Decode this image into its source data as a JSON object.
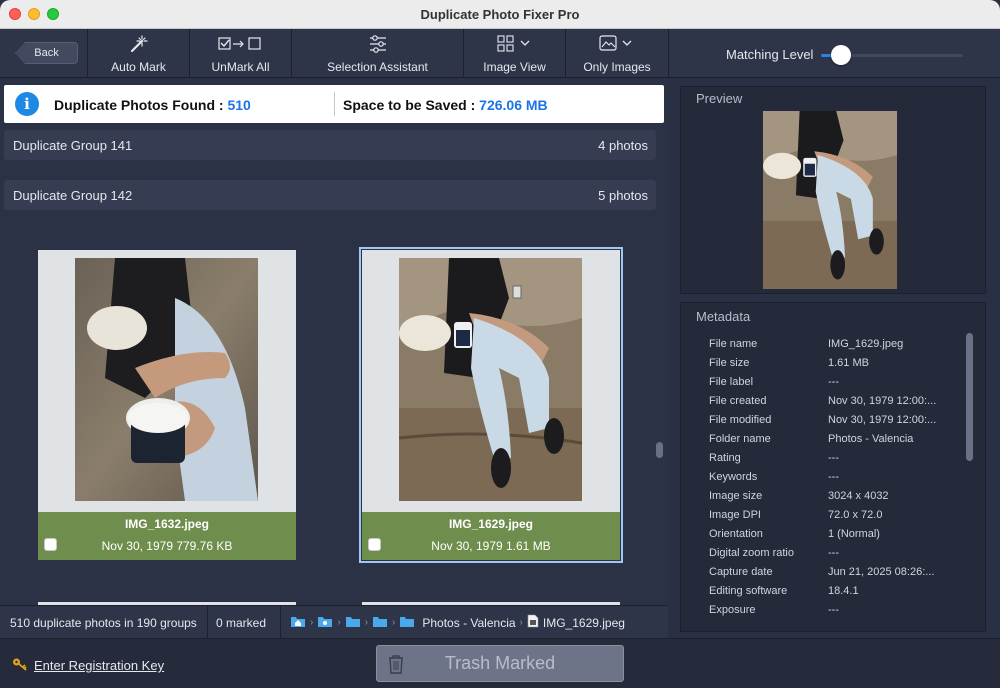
{
  "window": {
    "title": "Duplicate Photo Fixer Pro"
  },
  "toolbar": {
    "back_label": "Back",
    "auto_mark": "Auto Mark",
    "unmark_all": "UnMark All",
    "selection_assistant": "Selection Assistant",
    "image_view": "Image View",
    "only_images": "Only Images"
  },
  "matching": {
    "label": "Matching Level",
    "level": 0.1
  },
  "summary": {
    "found_label": "Duplicate Photos Found :",
    "found_value": "510",
    "space_label": "Space to be Saved :",
    "space_value": "726.06 MB"
  },
  "groups": [
    {
      "name": "Duplicate Group 141",
      "count": "4 photos"
    },
    {
      "name": "Duplicate Group 142",
      "count": "5 photos"
    }
  ],
  "photos": [
    {
      "file": "IMG_1632.jpeg",
      "meta": "Nov 30, 1979 779.76 KB",
      "checked": false
    },
    {
      "file": "IMG_1629.jpeg",
      "meta": "Nov 30, 1979 1.61 MB",
      "checked": false
    }
  ],
  "status": {
    "count": "510 duplicate photos in 190 groups",
    "marked": "0 marked",
    "folder": "Photos - Valencia",
    "file": "IMG_1629.jpeg"
  },
  "preview": {
    "title": "Preview"
  },
  "metadata": {
    "title": "Metadata",
    "rows": [
      {
        "k": "File name",
        "v": "IMG_1629.jpeg"
      },
      {
        "k": "File size",
        "v": "1.61 MB"
      },
      {
        "k": "File label",
        "v": "---"
      },
      {
        "k": "File created",
        "v": "Nov 30, 1979 12:00:..."
      },
      {
        "k": "File modified",
        "v": "Nov 30, 1979 12:00:..."
      },
      {
        "k": "Folder name",
        "v": "Photos - Valencia"
      },
      {
        "k": "Rating",
        "v": "---"
      },
      {
        "k": "Keywords",
        "v": "---"
      },
      {
        "k": "Image size",
        "v": "3024 x 4032"
      },
      {
        "k": "Image DPI",
        "v": "72.0 x 72.0"
      },
      {
        "k": "Orientation",
        "v": "1 (Normal)"
      },
      {
        "k": "Digital zoom ratio",
        "v": "---"
      },
      {
        "k": "Capture date",
        "v": "Jun 21, 2025 08:26:..."
      },
      {
        "k": "Editing software",
        "v": "18.4.1"
      },
      {
        "k": "Exposure",
        "v": "---"
      }
    ]
  },
  "bottom": {
    "register": "Enter Registration Key",
    "trash": "Trash Marked"
  },
  "colors": {
    "accent": "#1a73e8",
    "card_footer": "#6f8d4c",
    "panel_bg": "#2c3246"
  }
}
